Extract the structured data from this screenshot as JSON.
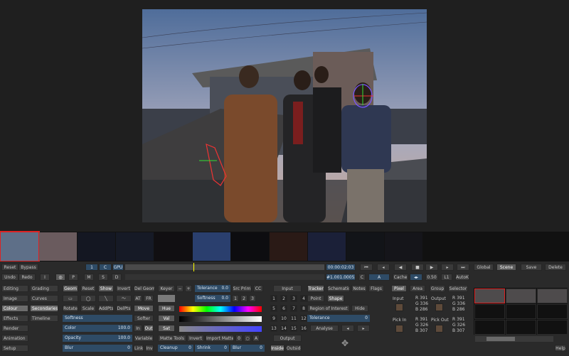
{
  "toolbar1": {
    "reset": "Reset",
    "bypass": "Bypass",
    "one": "1",
    "c": "C",
    "gpu": "GPU",
    "timecode": "00:00:02:03",
    "frame_no": "#1.001.00052",
    "c2": "C",
    "a": "A",
    "cache": "Cache",
    "val": "0.50",
    "l1": "L1",
    "autok": "AutoK",
    "global": "Global",
    "scene": "Scene",
    "save": "Save",
    "delete": "Delete"
  },
  "toolbar2": {
    "undo": "Undo",
    "redo": "Redo",
    "i": "I",
    "p": "P",
    "m": "M",
    "s": "S",
    "d": "D"
  },
  "left_menu": {
    "col1": [
      "Editing",
      "Image",
      "Colour",
      "Effects",
      "Render",
      "Animation",
      "Setup"
    ],
    "col2": [
      "Grading",
      "Curves",
      "Secondaries",
      "Timeline"
    ]
  },
  "geom": {
    "geom": "Geom",
    "reset": "Reset",
    "show": "Show",
    "invert": "Invert",
    "del_geom": "Del Geom",
    "keyer": "Keyer",
    "rotate": "Rotate",
    "scale": "Scale",
    "add_pts": "AddPts",
    "del_pts": "DelPts",
    "move": "Move",
    "at": "AT",
    "fr": "FR",
    "hue": "Hue",
    "val": "Val",
    "sat": "Sat",
    "softer": "Softer",
    "in": "In",
    "out": "Out",
    "variable": "Variable",
    "matte_tools": "Matte Tools",
    "invert2": "Invert",
    "import_matte": "Import Matte",
    "zero": "0",
    "a": "A",
    "link": "Link",
    "inv": "Inv"
  },
  "fields": {
    "softness": {
      "label": "Softness",
      "value": ""
    },
    "color": {
      "label": "Color",
      "value": "100.0"
    },
    "opacity": {
      "label": "Opacity",
      "value": "100.0"
    },
    "blur": {
      "label": "Blur",
      "value": "0"
    },
    "tolerance": {
      "label": "Tolerance",
      "value": "0.0"
    },
    "softness2": {
      "label": "Softness",
      "value": "0.0"
    },
    "cleanup": {
      "label": "Cleanup",
      "value": "0"
    },
    "shrink": {
      "label": "Shrink",
      "value": "0"
    },
    "blur2": {
      "label": "Blur",
      "value": "0"
    },
    "tolerance2": {
      "label": "Tolerance",
      "value": "0"
    }
  },
  "src_prim": "Src Prim",
  "cc": "CC",
  "keypad": {
    "input": "Input",
    "output": "Output",
    "inside": "Inside",
    "outside": "Outside",
    "rows": [
      [
        "1",
        "2",
        "3",
        "4"
      ],
      [
        "5",
        "6",
        "7",
        "8"
      ],
      [
        "9",
        "10",
        "11",
        "12"
      ],
      [
        "13",
        "14",
        "15",
        "16"
      ]
    ]
  },
  "tracker": {
    "tracker": "Tracker",
    "schematic": "Schematic",
    "notes": "Notes",
    "flags": "Flags",
    "point": "Point",
    "shape": "Shape",
    "region": "Region of Interest",
    "hide": "Hide",
    "analyse": "Analyse"
  },
  "pixel": {
    "pixel": "Pixel",
    "area": "Area",
    "group": "Group",
    "selector": "Selector",
    "input": "Input",
    "output": "Output",
    "pick_in": "Pick In",
    "pick_out": "Pick Out",
    "in_vals": [
      "R  391",
      "G  336",
      "B  286"
    ],
    "out_vals": [
      "R  391",
      "G  336",
      "B  286"
    ],
    "pickin_vals": [
      "R  391",
      "G  326",
      "B  307"
    ],
    "pickout_vals": [
      "R  391",
      "G  326",
      "B  307"
    ],
    "help": "Help"
  },
  "colors": {
    "accent": "#2e4b66",
    "highlight": "#d22222"
  }
}
